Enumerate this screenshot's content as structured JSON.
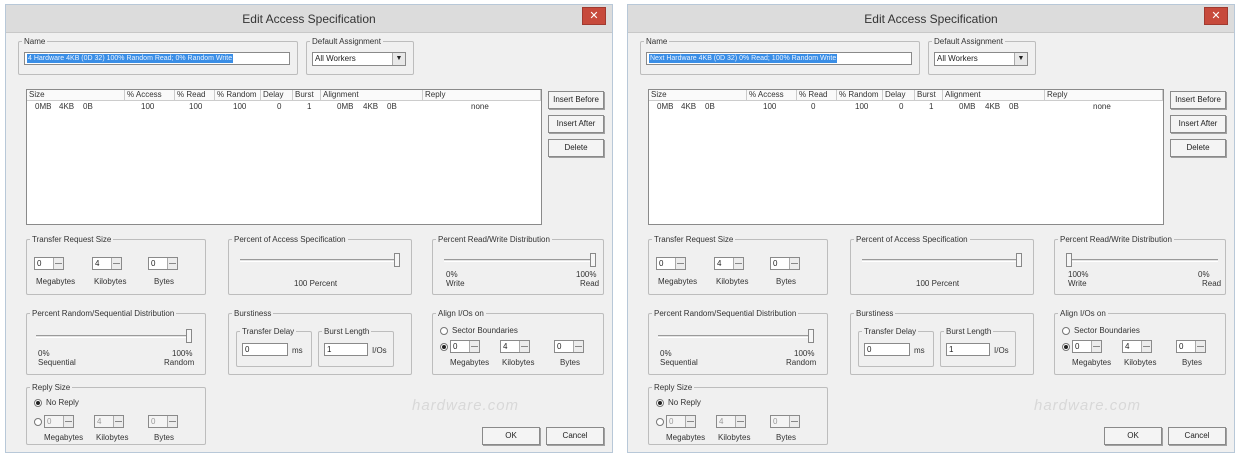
{
  "windows": [
    {
      "title": "Edit Access Specification",
      "name_legend": "Name",
      "name_value": "4 Hardware 4KB (0D 32) 100% Random Read; 0% Random Write",
      "default_assignment_legend": "Default Assignment",
      "default_assignment_value": "All Workers",
      "list_headers": [
        "Size",
        "% Access",
        "% Read",
        "% Random",
        "Delay",
        "Burst",
        "Alignment",
        "Reply"
      ],
      "list_row": [
        "0MB",
        "4KB",
        "0B",
        "100",
        "100",
        "100",
        "0",
        "1",
        "0MB",
        "4KB",
        "0B",
        "none"
      ],
      "buttons": {
        "insert_before": "Insert Before",
        "insert_after": "Insert After",
        "delete": "Delete",
        "ok": "OK",
        "cancel": "Cancel"
      },
      "transfer_size": {
        "legend": "Transfer Request Size",
        "mb": "0",
        "kb": "4",
        "b": "0",
        "mb_label": "Megabytes",
        "kb_label": "Kilobytes",
        "b_label": "Bytes"
      },
      "percent_access": {
        "legend": "Percent of Access Specification",
        "value_label": "100 Percent",
        "fraction": 1.0
      },
      "read_write": {
        "legend": "Percent Read/Write Distribution",
        "left_pct": "0%",
        "left_label": "Write",
        "right_pct": "100%",
        "right_label": "Read",
        "fraction": 1.0
      },
      "random_seq": {
        "legend": "Percent Random/Sequential Distribution",
        "left_pct": "0%",
        "left_label": "Sequential",
        "right_pct": "100%",
        "right_label": "Random",
        "fraction": 1.0
      },
      "burstiness": {
        "legend": "Burstiness",
        "delay_legend": "Transfer Delay",
        "delay_value": "0",
        "delay_unit": "ms",
        "burst_legend": "Burst Length",
        "burst_value": "1",
        "burst_unit": "I/Os"
      },
      "align": {
        "legend": "Align I/Os on",
        "sector_label": "Sector Boundaries",
        "mb": "0",
        "kb": "4",
        "b": "0",
        "mb_label": "Megabytes",
        "kb_label": "Kilobytes",
        "b_label": "Bytes"
      },
      "reply": {
        "legend": "Reply Size",
        "no_reply_label": "No Reply",
        "mb": "0",
        "kb": "4",
        "b": "0",
        "mb_label": "Megabytes",
        "kb_label": "Kilobytes",
        "b_label": "Bytes"
      },
      "watermark": "hardware.com"
    },
    {
      "title": "Edit Access Specification",
      "name_legend": "Name",
      "name_value": "Next Hardware 4KB (0D 32) 0% Read; 100% Random Write",
      "default_assignment_legend": "Default Assignment",
      "default_assignment_value": "All Workers",
      "list_headers": [
        "Size",
        "% Access",
        "% Read",
        "% Random",
        "Delay",
        "Burst",
        "Alignment",
        "Reply"
      ],
      "list_row": [
        "0MB",
        "4KB",
        "0B",
        "100",
        "0",
        "100",
        "0",
        "1",
        "0MB",
        "4KB",
        "0B",
        "none"
      ],
      "buttons": {
        "insert_before": "Insert Before",
        "insert_after": "Insert After",
        "delete": "Delete",
        "ok": "OK",
        "cancel": "Cancel"
      },
      "transfer_size": {
        "legend": "Transfer Request Size",
        "mb": "0",
        "kb": "4",
        "b": "0",
        "mb_label": "Megabytes",
        "kb_label": "Kilobytes",
        "b_label": "Bytes"
      },
      "percent_access": {
        "legend": "Percent of Access Specification",
        "value_label": "100 Percent",
        "fraction": 1.0
      },
      "read_write": {
        "legend": "Percent Read/Write Distribution",
        "left_pct": "100%",
        "left_label": "Write",
        "right_pct": "0%",
        "right_label": "Read",
        "fraction": 0.0
      },
      "random_seq": {
        "legend": "Percent Random/Sequential Distribution",
        "left_pct": "0%",
        "left_label": "Sequential",
        "right_pct": "100%",
        "right_label": "Random",
        "fraction": 1.0
      },
      "burstiness": {
        "legend": "Burstiness",
        "delay_legend": "Transfer Delay",
        "delay_value": "0",
        "delay_unit": "ms",
        "burst_legend": "Burst Length",
        "burst_value": "1",
        "burst_unit": "I/Os"
      },
      "align": {
        "legend": "Align I/Os on",
        "sector_label": "Sector Boundaries",
        "mb": "0",
        "kb": "4",
        "b": "0",
        "mb_label": "Megabytes",
        "kb_label": "Kilobytes",
        "b_label": "Bytes"
      },
      "reply": {
        "legend": "Reply Size",
        "no_reply_label": "No Reply",
        "mb": "0",
        "kb": "4",
        "b": "0",
        "mb_label": "Megabytes",
        "kb_label": "Kilobytes",
        "b_label": "Bytes"
      },
      "watermark": "hardware.com"
    }
  ]
}
